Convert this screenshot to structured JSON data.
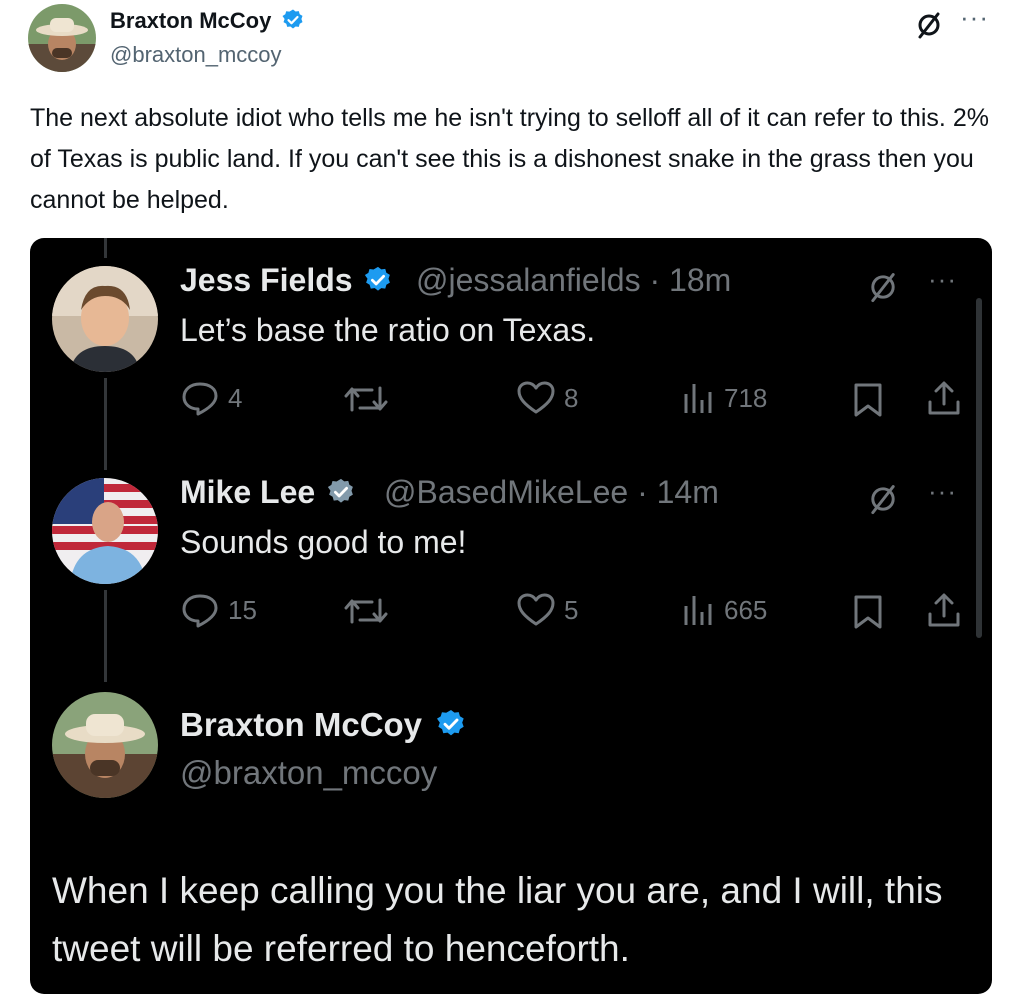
{
  "outer": {
    "author_name": "Braxton McCoy",
    "author_handle": "@braxton_mccoy",
    "text": "The next absolute idiot who tells me he isn't trying to selloff all of it can refer to this. 2% of Texas is public land. If you can't see this is a dishonest snake in the grass then you cannot be helped.",
    "more": "···"
  },
  "replies": [
    {
      "name": "Jess Fields",
      "handle_time": "@jessalanfields · 18m",
      "text": "Let’s base the ratio on Texas.",
      "replies": "4",
      "reposts": "",
      "likes": "8",
      "views": "718",
      "more": "···"
    },
    {
      "name": "Mike Lee",
      "handle_time": "@BasedMikeLee · 14m",
      "text": "Sounds good to me!",
      "replies": "15",
      "reposts": "",
      "likes": "5",
      "views": "665",
      "more": "···"
    }
  ],
  "quote": {
    "name": "Braxton McCoy",
    "handle": "@braxton_mccoy",
    "text": "When I keep calling you the liar you are, and I will, this tweet will be referred to henceforth."
  },
  "icons": {
    "verified": "verified-badge-icon",
    "grok": "grok-icon",
    "reply": "reply-icon",
    "repost": "repost-icon",
    "like": "like-icon",
    "views": "views-icon",
    "bookmark": "bookmark-icon",
    "share": "share-icon"
  },
  "colors": {
    "verified_blue": "#1d9bf0",
    "dark_bg": "#000000",
    "muted_gray": "#71767b"
  }
}
